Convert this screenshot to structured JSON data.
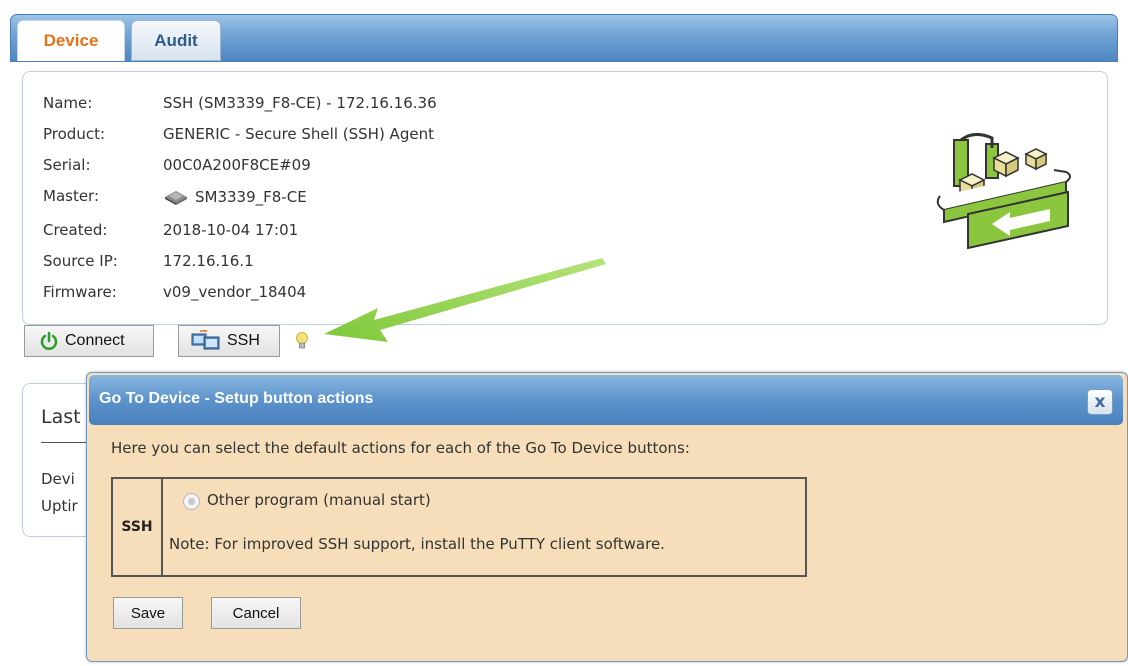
{
  "tabs": [
    {
      "label": "Device",
      "active": true
    },
    {
      "label": "Audit",
      "active": false
    }
  ],
  "device": {
    "rows": [
      {
        "label": "Name:",
        "value": "SSH (SM3339_F8-CE) - 172.16.16.36"
      },
      {
        "label": "Product:",
        "value": "GENERIC - Secure Shell (SSH) Agent"
      },
      {
        "label": "Serial:",
        "value": "00C0A200F8CE#09"
      },
      {
        "label": "Master:",
        "value": "SM3339_F8-CE",
        "icon": "device-icon"
      },
      {
        "label": "Created:",
        "value": "2018-10-04 17:01"
      },
      {
        "label": "Source IP:",
        "value": "172.16.16.1"
      },
      {
        "label": "Firmware:",
        "value": "v09_vendor_18404"
      }
    ]
  },
  "actions": {
    "connect_label": "Connect",
    "ssh_label": "SSH",
    "connect_icon": "power-icon",
    "ssh_icon": "remote-terminal-icon",
    "hint_icon": "lightbulb-icon"
  },
  "last_panel": {
    "title_fragment": "Last",
    "line1_fragment": "Devi",
    "line2_fragment": "Uptir"
  },
  "dialog": {
    "title": "Go To Device - Setup button actions",
    "close_label": "x",
    "intro": "Here you can select the default actions for each of the Go To Device buttons:",
    "section_label": "SSH",
    "option_label": "Other program (manual start)",
    "note": "Note: For improved SSH support, install the PuTTY client software.",
    "save_label": "Save",
    "cancel_label": "Cancel"
  },
  "colors": {
    "accent_tab": "#e3731b",
    "header_blue": "#5d93cb",
    "dialog_bg": "#f6deba",
    "arrow_green": "#8fd143"
  }
}
